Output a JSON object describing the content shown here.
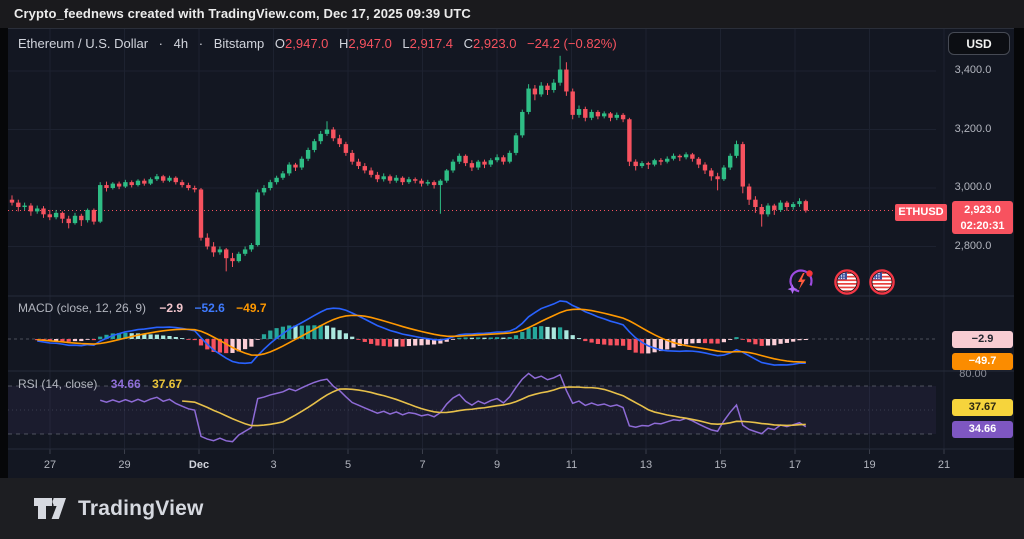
{
  "header": {
    "text": "Crypto_feednews created with TradingView.com, Dec 17, 2025 09:39 UTC"
  },
  "toolbar": {
    "currency": "USD"
  },
  "chart": {
    "title_row": {
      "symbol": "Ethereum / U.S. Dollar",
      "sep": "·",
      "interval": "4h",
      "exchange": "Bitstamp",
      "o_label": "O",
      "o": "2,947.0",
      "h_label": "H",
      "h": "2,947.0",
      "l_label": "L",
      "l": "2,917.4",
      "c_label": "C",
      "c": "2,923.0",
      "change": "−24.2 (−0.82%)"
    },
    "symbol_badge": "ETHUSD",
    "price_badge": {
      "price": "2,923.0",
      "countdown": "02:20:31"
    },
    "price_axis": [
      "3,400.0",
      "3,200.0",
      "3,000.0",
      "2,800.0"
    ],
    "time_axis": [
      "27",
      "29",
      "Dec",
      "3",
      "5",
      "7",
      "9",
      "11",
      "13",
      "15",
      "17",
      "19",
      "21"
    ]
  },
  "macd": {
    "label": "MACD (close, 12, 26, 9)",
    "hist": "−2.9",
    "macd": "−52.6",
    "signal": "−49.7"
  },
  "rsi": {
    "label": "RSI (14, close)",
    "value": "34.66",
    "ma": "37.67",
    "axis_top": "80.00"
  },
  "icons": {
    "spark": "ai-spark-icon",
    "flag_left": "us-flag-icon",
    "flag_right": "us-flag-icon"
  },
  "footer": {
    "brand": "TradingView"
  },
  "colors": {
    "up": "#2ebd85",
    "down": "#f7525f",
    "macd_line": "#2962ff",
    "signal_line": "#ff9800",
    "hist_pos": "#26a69a",
    "hist_pos_weak": "#ace8df",
    "hist_neg": "#f7525f",
    "hist_neg_weak": "#fbced6",
    "rsi_line": "#8e6bd6",
    "rsi_ma_line": "#e7c04a",
    "accent_red": "#f7525f",
    "bg": "#131722"
  },
  "chart_data": {
    "type": "candlestick",
    "symbol": "ETHUSD",
    "exchange": "Bitstamp",
    "interval": "4h",
    "last_price": 2923.0,
    "last_change": -24.2,
    "last_change_pct": -0.82,
    "price_axis_ticks": [
      3400,
      3200,
      3000,
      2800
    ],
    "time_ticks": [
      "27",
      "29",
      "Dec",
      "3",
      "5",
      "7",
      "9",
      "11",
      "13",
      "15",
      "17",
      "19",
      "21"
    ],
    "macd_settings": {
      "source": "close",
      "fast": 12,
      "slow": 26,
      "signal": 9,
      "last": {
        "hist": -2.9,
        "macd": -52.6,
        "signal": -49.7
      }
    },
    "rsi_settings": {
      "length": 14,
      "source": "close",
      "levels": [
        80,
        70,
        50,
        30
      ],
      "last": {
        "rsi": 34.66,
        "ma": 37.67
      }
    },
    "candles_ohlc": [
      [
        2960,
        2975,
        2940,
        2950
      ],
      [
        2950,
        2960,
        2920,
        2935
      ],
      [
        2935,
        2950,
        2925,
        2940
      ],
      [
        2940,
        2948,
        2905,
        2920
      ],
      [
        2920,
        2940,
        2912,
        2930
      ],
      [
        2930,
        2938,
        2898,
        2910
      ],
      [
        2910,
        2925,
        2890,
        2900
      ],
      [
        2900,
        2925,
        2893,
        2915
      ],
      [
        2915,
        2920,
        2880,
        2895
      ],
      [
        2895,
        2905,
        2862,
        2880
      ],
      [
        2880,
        2915,
        2875,
        2905
      ],
      [
        2905,
        2912,
        2870,
        2890
      ],
      [
        2890,
        2930,
        2882,
        2925
      ],
      [
        2925,
        2930,
        2875,
        2885
      ],
      [
        2885,
        3020,
        2880,
        3010
      ],
      [
        3010,
        3022,
        2988,
        3000
      ],
      [
        3000,
        3020,
        2995,
        3015
      ],
      [
        3015,
        3022,
        2996,
        3005
      ],
      [
        3005,
        3028,
        3000,
        3020
      ],
      [
        3020,
        3026,
        3002,
        3010
      ],
      [
        3010,
        3030,
        3005,
        3025
      ],
      [
        3025,
        3032,
        3008,
        3015
      ],
      [
        3015,
        3036,
        3010,
        3030
      ],
      [
        3030,
        3048,
        3024,
        3040
      ],
      [
        3040,
        3045,
        3018,
        3025
      ],
      [
        3025,
        3042,
        3020,
        3035
      ],
      [
        3035,
        3040,
        3012,
        3020
      ],
      [
        3020,
        3028,
        3002,
        3010
      ],
      [
        3010,
        3018,
        2992,
        3000
      ],
      [
        3000,
        3008,
        2985,
        2995
      ],
      [
        2995,
        3000,
        2820,
        2830
      ],
      [
        2830,
        2845,
        2790,
        2800
      ],
      [
        2800,
        2815,
        2765,
        2780
      ],
      [
        2780,
        2800,
        2772,
        2790
      ],
      [
        2790,
        2795,
        2715,
        2760
      ],
      [
        2760,
        2778,
        2730,
        2750
      ],
      [
        2750,
        2782,
        2745,
        2775
      ],
      [
        2775,
        2800,
        2768,
        2790
      ],
      [
        2790,
        2812,
        2782,
        2805
      ],
      [
        2805,
        2995,
        2800,
        2985
      ],
      [
        2985,
        3010,
        2975,
        3000
      ],
      [
        3000,
        3028,
        2992,
        3020
      ],
      [
        3020,
        3042,
        3012,
        3035
      ],
      [
        3035,
        3058,
        3028,
        3050
      ],
      [
        3050,
        3088,
        3042,
        3080
      ],
      [
        3080,
        3086,
        3058,
        3070
      ],
      [
        3070,
        3108,
        3062,
        3100
      ],
      [
        3100,
        3138,
        3092,
        3130
      ],
      [
        3130,
        3168,
        3122,
        3160
      ],
      [
        3160,
        3195,
        3150,
        3185
      ],
      [
        3185,
        3228,
        3178,
        3200
      ],
      [
        3200,
        3208,
        3160,
        3170
      ],
      [
        3170,
        3182,
        3140,
        3150
      ],
      [
        3150,
        3158,
        3110,
        3120
      ],
      [
        3120,
        3130,
        3080,
        3090
      ],
      [
        3090,
        3100,
        3065,
        3075
      ],
      [
        3075,
        3085,
        3050,
        3060
      ],
      [
        3060,
        3070,
        3036,
        3045
      ],
      [
        3045,
        3055,
        3020,
        3030
      ],
      [
        3030,
        3050,
        3022,
        3040
      ],
      [
        3040,
        3046,
        3015,
        3025
      ],
      [
        3025,
        3044,
        3018,
        3035
      ],
      [
        3035,
        3040,
        3010,
        3020
      ],
      [
        3020,
        3038,
        3014,
        3030
      ],
      [
        3030,
        3036,
        3016,
        3025
      ],
      [
        3025,
        3032,
        3005,
        3015
      ],
      [
        3015,
        3028,
        3008,
        3020
      ],
      [
        3020,
        3026,
        2998,
        3010
      ],
      [
        3010,
        3030,
        2912,
        3025
      ],
      [
        3025,
        3065,
        3018,
        3060
      ],
      [
        3060,
        3098,
        3052,
        3090
      ],
      [
        3090,
        3118,
        3082,
        3110
      ],
      [
        3110,
        3115,
        3075,
        3085
      ],
      [
        3085,
        3095,
        3058,
        3070
      ],
      [
        3070,
        3096,
        3062,
        3090
      ],
      [
        3090,
        3097,
        3068,
        3080
      ],
      [
        3080,
        3102,
        3072,
        3095
      ],
      [
        3095,
        3115,
        3088,
        3105
      ],
      [
        3105,
        3112,
        3080,
        3090
      ],
      [
        3090,
        3128,
        3084,
        3120
      ],
      [
        3120,
        3188,
        3112,
        3180
      ],
      [
        3180,
        3268,
        3172,
        3260
      ],
      [
        3260,
        3355,
        3252,
        3340
      ],
      [
        3340,
        3352,
        3300,
        3320
      ],
      [
        3320,
        3362,
        3312,
        3350
      ],
      [
        3350,
        3358,
        3318,
        3335
      ],
      [
        3335,
        3372,
        3326,
        3360
      ],
      [
        3360,
        3452,
        3350,
        3405
      ],
      [
        3405,
        3430,
        3315,
        3330
      ],
      [
        3330,
        3340,
        3235,
        3250
      ],
      [
        3250,
        3282,
        3240,
        3270
      ],
      [
        3270,
        3278,
        3228,
        3240
      ],
      [
        3240,
        3268,
        3232,
        3260
      ],
      [
        3260,
        3266,
        3235,
        3245
      ],
      [
        3245,
        3262,
        3238,
        3255
      ],
      [
        3255,
        3260,
        3228,
        3240
      ],
      [
        3240,
        3258,
        3232,
        3250
      ],
      [
        3250,
        3256,
        3225,
        3235
      ],
      [
        3235,
        3240,
        3075,
        3090
      ],
      [
        3090,
        3098,
        3060,
        3075
      ],
      [
        3075,
        3092,
        3068,
        3085
      ],
      [
        3085,
        3090,
        3065,
        3080
      ],
      [
        3080,
        3100,
        3074,
        3095
      ],
      [
        3095,
        3102,
        3078,
        3090
      ],
      [
        3090,
        3108,
        3084,
        3100
      ],
      [
        3100,
        3118,
        3094,
        3110
      ],
      [
        3110,
        3115,
        3092,
        3105
      ],
      [
        3105,
        3122,
        3098,
        3115
      ],
      [
        3115,
        3120,
        3090,
        3100
      ],
      [
        3100,
        3106,
        3068,
        3080
      ],
      [
        3080,
        3088,
        3048,
        3060
      ],
      [
        3060,
        3068,
        3025,
        3040
      ],
      [
        3040,
        3052,
        2992,
        3030
      ],
      [
        3030,
        3078,
        3024,
        3070
      ],
      [
        3070,
        3118,
        3062,
        3110
      ],
      [
        3110,
        3162,
        3102,
        3150
      ],
      [
        3150,
        3158,
        2982,
        3005
      ],
      [
        3005,
        3015,
        2942,
        2960
      ],
      [
        2960,
        2972,
        2915,
        2935
      ],
      [
        2935,
        2945,
        2868,
        2910
      ],
      [
        2910,
        2948,
        2902,
        2940
      ],
      [
        2940,
        2946,
        2908,
        2925
      ],
      [
        2925,
        2958,
        2918,
        2950
      ],
      [
        2950,
        2956,
        2922,
        2935
      ],
      [
        2935,
        2952,
        2926,
        2945
      ],
      [
        2945,
        2965,
        2936,
        2955
      ],
      [
        2955,
        2960,
        2916,
        2923
      ]
    ]
  }
}
